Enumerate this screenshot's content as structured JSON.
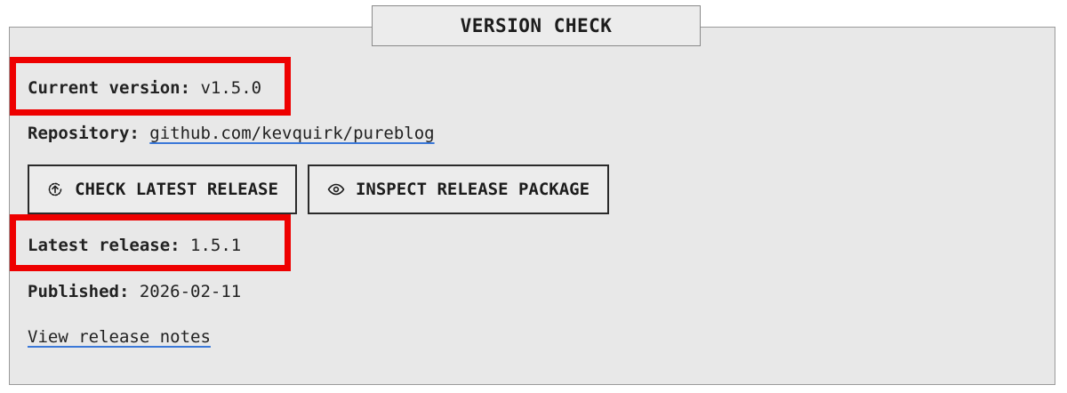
{
  "header": {
    "title": "VERSION CHECK"
  },
  "current": {
    "label": "Current version:",
    "value": "v1.5.0"
  },
  "repository": {
    "label": "Repository:",
    "link_text": "github.com/kevquirk/pureblog"
  },
  "buttons": {
    "check_label": "CHECK LATEST RELEASE",
    "check_icon": "upload-circle-icon",
    "inspect_label": "INSPECT RELEASE PACKAGE",
    "inspect_icon": "eye-icon"
  },
  "latest": {
    "label": "Latest release:",
    "value": "1.5.1"
  },
  "published": {
    "label": "Published:",
    "value": "2026-02-11"
  },
  "notes": {
    "link_text": "View release notes"
  },
  "colors": {
    "highlight": "#ee0000",
    "link_underline": "#3a78d8",
    "panel_bg": "#e8e8e8"
  }
}
